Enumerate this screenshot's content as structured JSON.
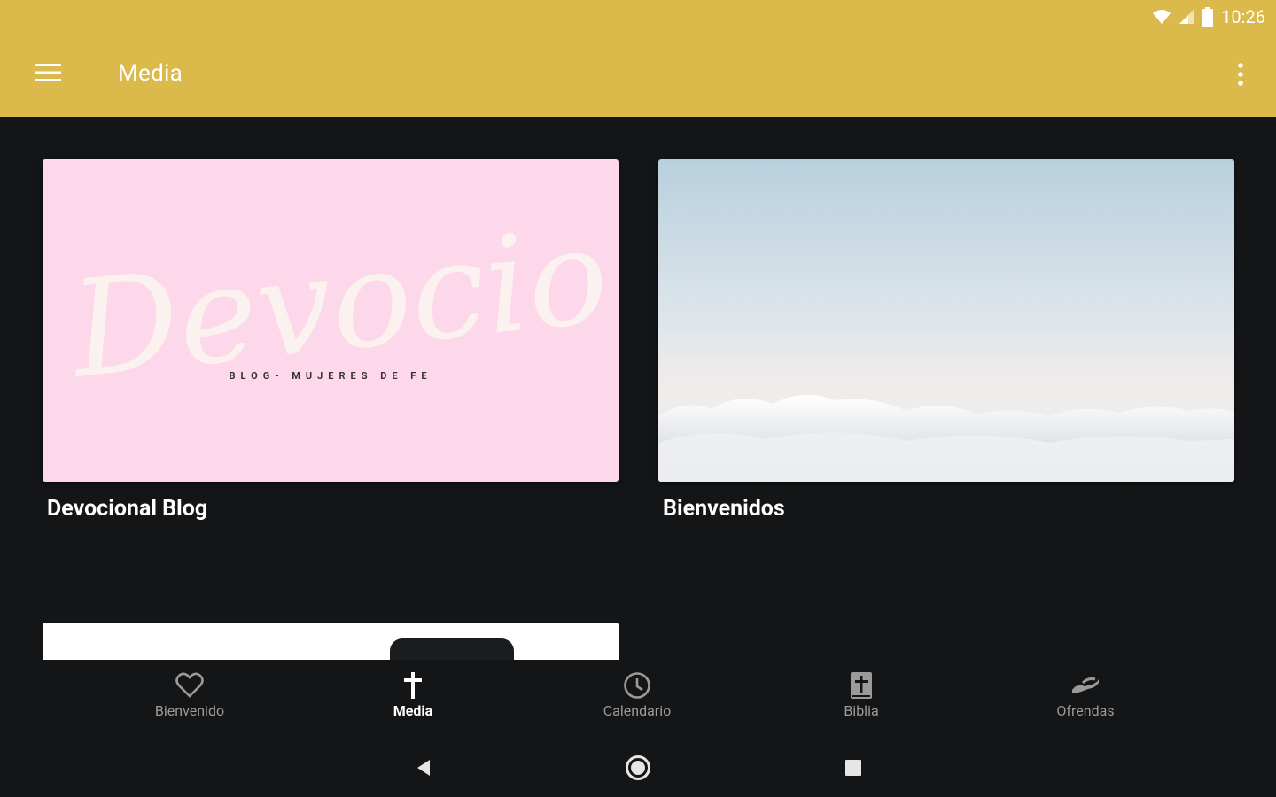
{
  "status_bar": {
    "time": "10:26"
  },
  "app_bar": {
    "title": "Media",
    "accent_color": "#dbb94a"
  },
  "cards": [
    {
      "title": "Devocional Blog",
      "image_text": "Devocional",
      "image_subtext": "BLOG- MUJERES DE FE"
    },
    {
      "title": "Bienvenidos"
    }
  ],
  "bottom_nav": {
    "items": [
      {
        "label": "Bienvenido",
        "icon": "heart-icon"
      },
      {
        "label": "Media",
        "icon": "cross-icon",
        "active": true
      },
      {
        "label": "Calendario",
        "icon": "clock-icon"
      },
      {
        "label": "Biblia",
        "icon": "bible-icon"
      },
      {
        "label": "Ofrendas",
        "icon": "offering-hand-icon"
      }
    ]
  },
  "system_nav": {
    "icons": [
      "back-icon",
      "home-icon",
      "recents-icon"
    ]
  }
}
